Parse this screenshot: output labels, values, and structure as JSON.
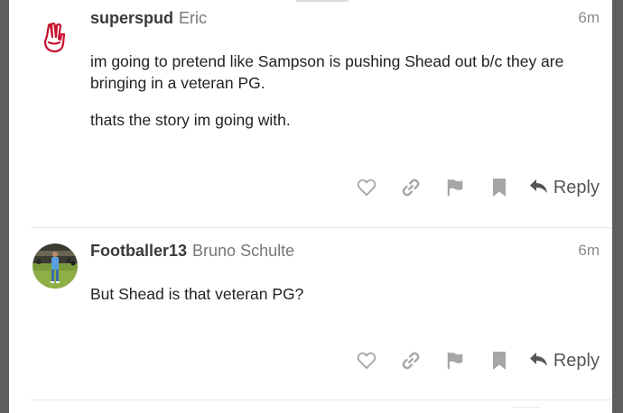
{
  "posts": [
    {
      "username": "superspud",
      "fullname": "Eric",
      "time": "6m",
      "avatar": "hand-w-logo-icon",
      "paragraphs": [
        "im going to pretend like Sampson is pushing Shead out b/c they are bringing in a veteran PG.",
        "thats the story im going with."
      ],
      "reply_label": "Reply"
    },
    {
      "username": "Footballer13",
      "fullname": "Bruno Schulte",
      "time": "6m",
      "avatar": "football-player-photo",
      "paragraphs": [
        "But Shead is that veteran PG?"
      ],
      "reply_label": "Reply"
    }
  ],
  "icons": {
    "like": "heart-icon",
    "link": "link-icon",
    "flag": "flag-icon",
    "bookmark": "bookmark-icon",
    "reply": "reply-arrow-icon"
  },
  "colors": {
    "page_background": "#5e5e5e",
    "icon_gray": "#a6a6a6",
    "logo_red": "#c8102e"
  }
}
